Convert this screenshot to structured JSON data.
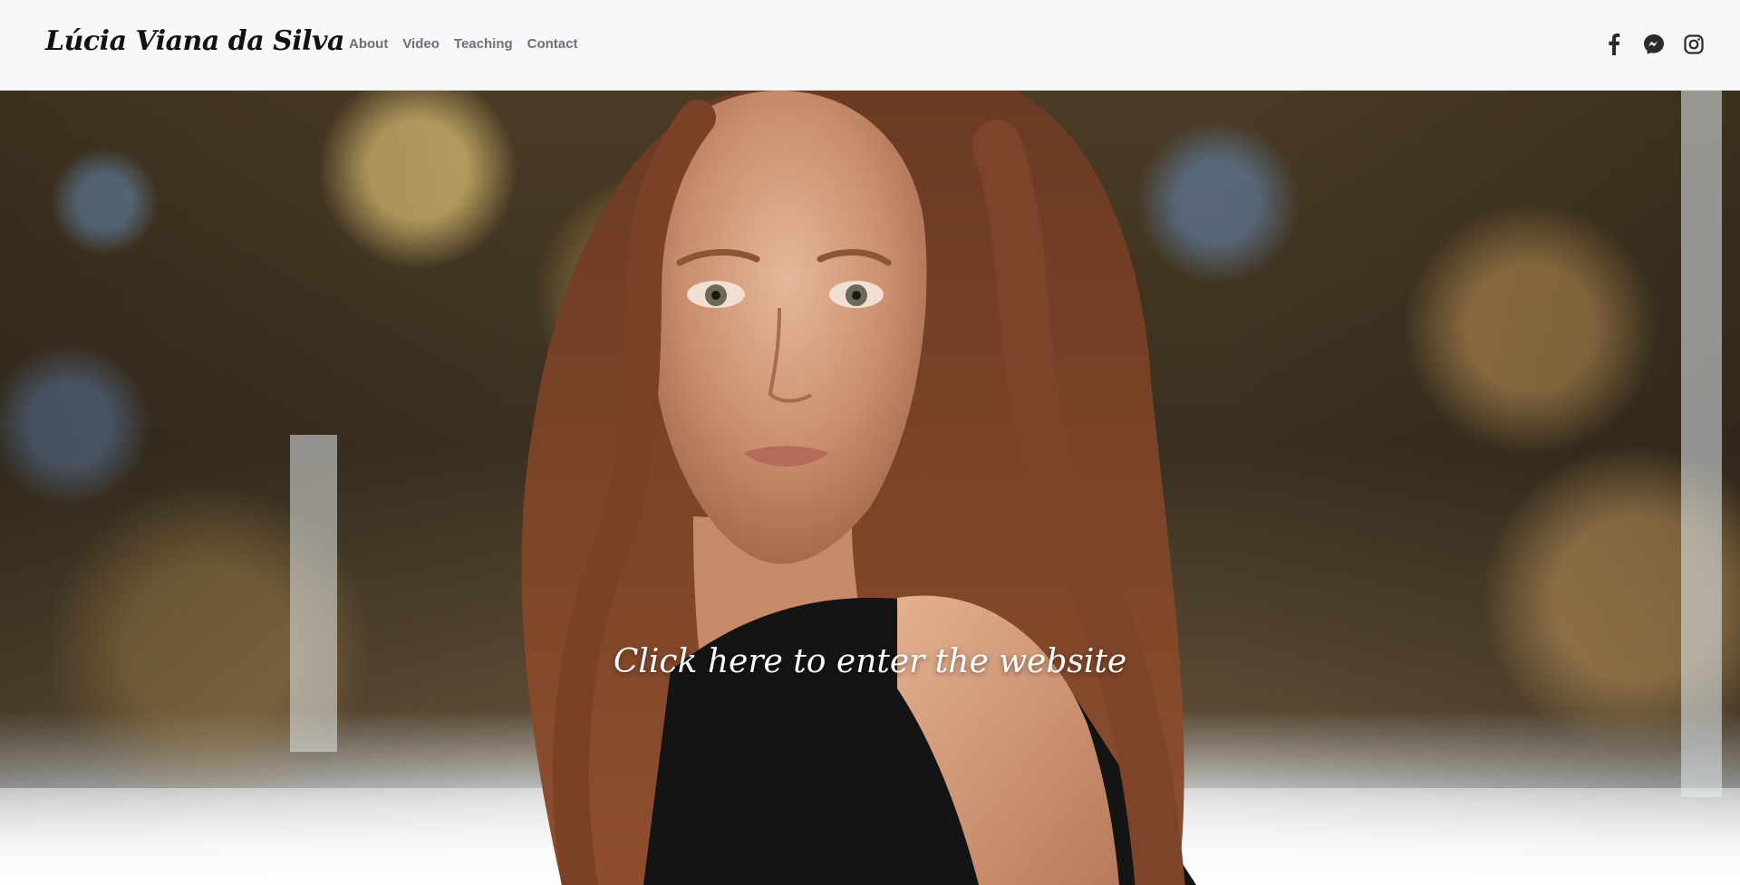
{
  "brand": {
    "name": "Lúcia Viana da Silva"
  },
  "nav": {
    "items": [
      "About",
      "Video",
      "Teaching",
      "Contact"
    ]
  },
  "social": {
    "icons": [
      "facebook-icon",
      "messenger-icon",
      "instagram-icon"
    ]
  },
  "hero": {
    "cta_label": "Click here to enter the website",
    "image": "portrait-photo"
  },
  "colors": {
    "nav_text": "#6b6f78",
    "brand_text": "#111111",
    "topbar_bg": "#f7f8fa",
    "cta_text": "#ffffff"
  }
}
